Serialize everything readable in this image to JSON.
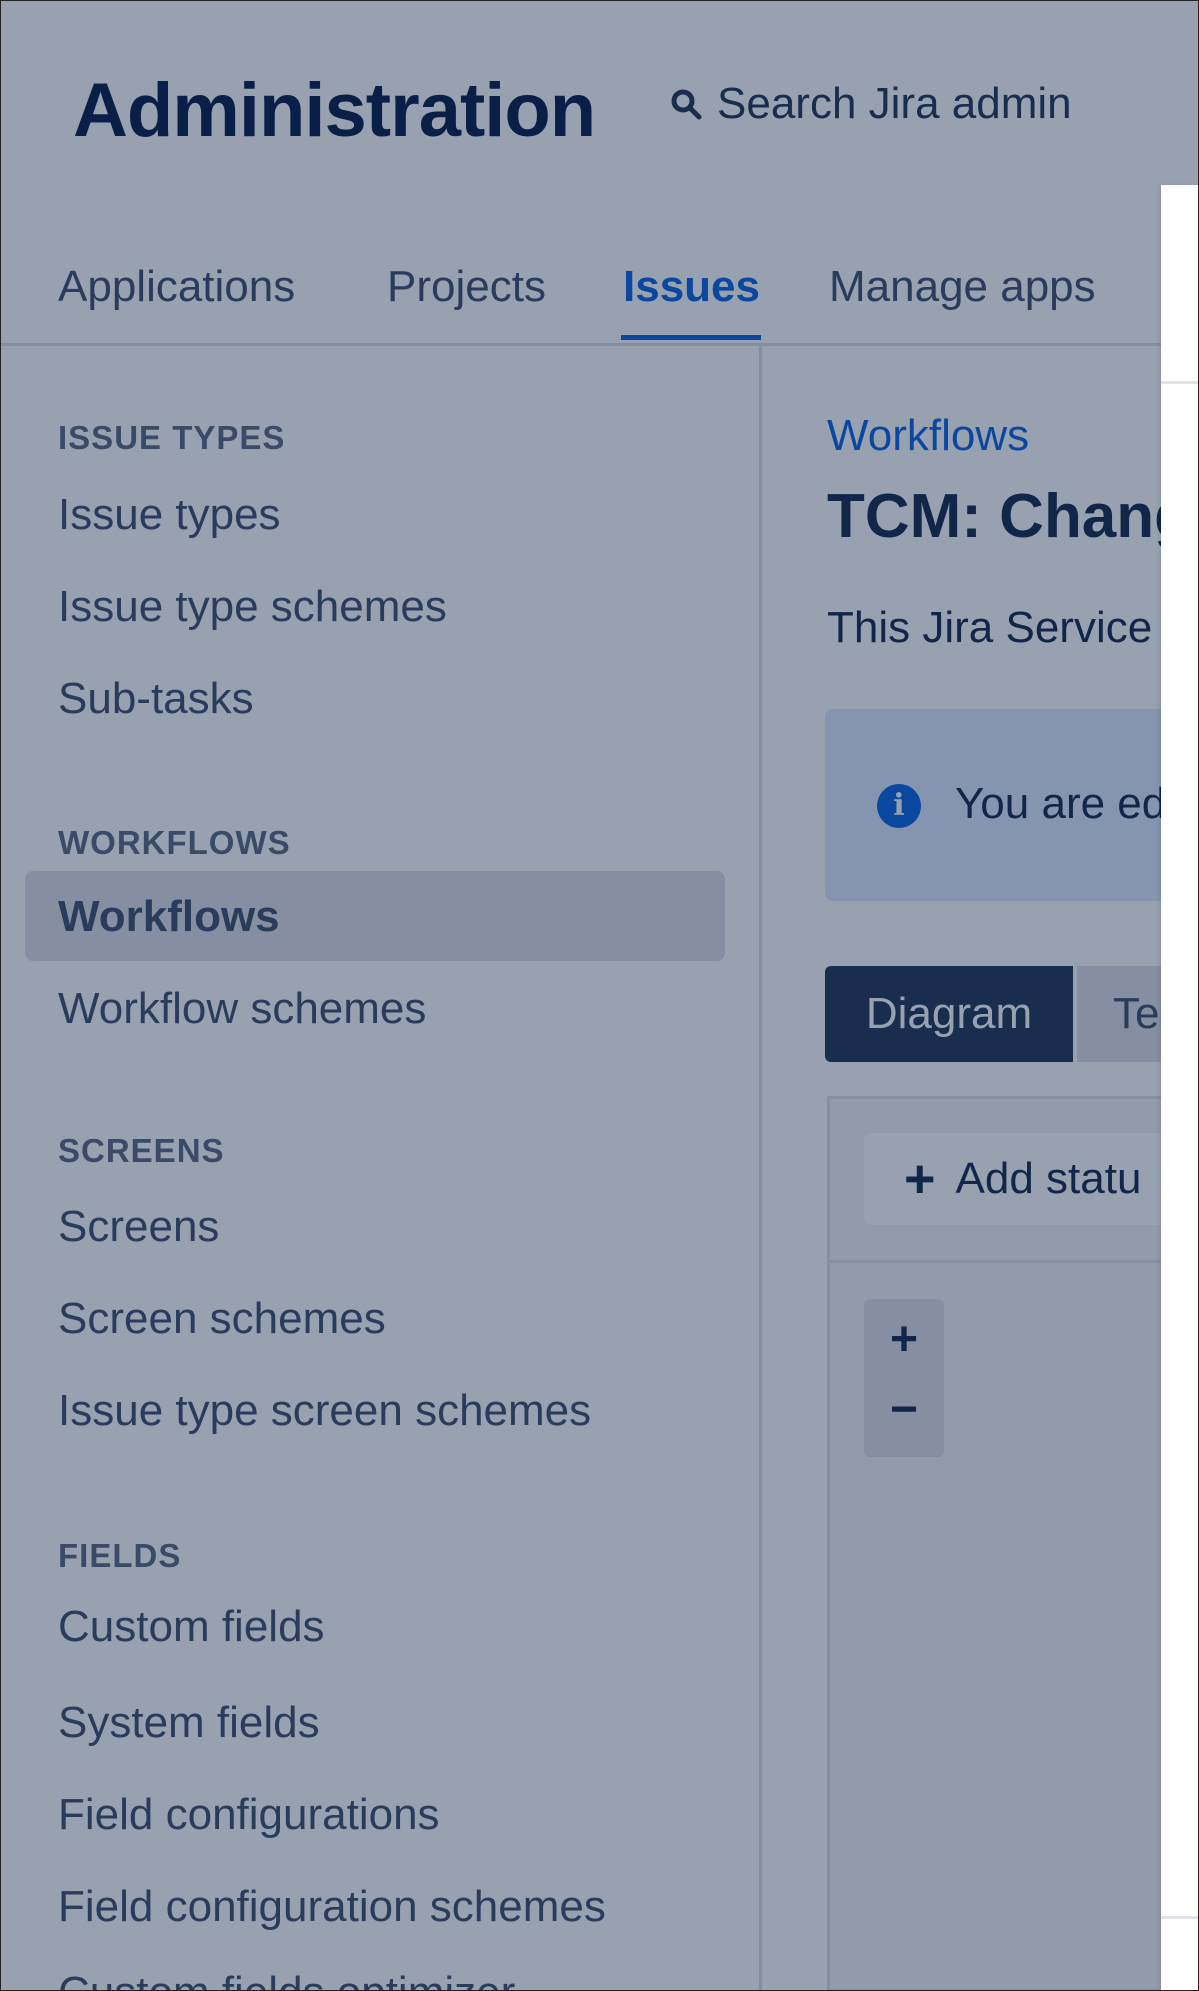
{
  "header": {
    "title": "Administration",
    "search_label": "Search Jira admin"
  },
  "nav": {
    "tabs": [
      "Applications",
      "Projects",
      "Issues",
      "Manage apps"
    ],
    "active": "Issues"
  },
  "sidebar": {
    "sections": [
      {
        "heading": "ISSUE TYPES",
        "items": [
          "Issue types",
          "Issue type schemes",
          "Sub-tasks"
        ]
      },
      {
        "heading": "WORKFLOWS",
        "items": [
          "Workflows",
          "Workflow schemes"
        ]
      },
      {
        "heading": "SCREENS",
        "items": [
          "Screens",
          "Screen schemes",
          "Issue type screen schemes"
        ]
      },
      {
        "heading": "FIELDS",
        "items": [
          "Custom fields",
          "System fields",
          "Field configurations",
          "Field configuration schemes",
          "Custom fields optimizer"
        ]
      }
    ],
    "selected": "Workflows"
  },
  "main": {
    "breadcrumb": "Workflows",
    "title": "TCM: Chang",
    "description": "This Jira Service",
    "info_text": "You are ed",
    "view_tabs": [
      "Diagram",
      "Te"
    ],
    "add_status_label": "Add statu",
    "zoom_in": "+",
    "zoom_out": "−"
  },
  "colors": {
    "overlay": "rgba(9,30,66,0.42)",
    "accent": "#0c66e4",
    "text_dark": "#172b4d",
    "selected_tab_bg": "#253858"
  },
  "icons": [
    "search-icon",
    "info-icon",
    "plus-icon"
  ]
}
